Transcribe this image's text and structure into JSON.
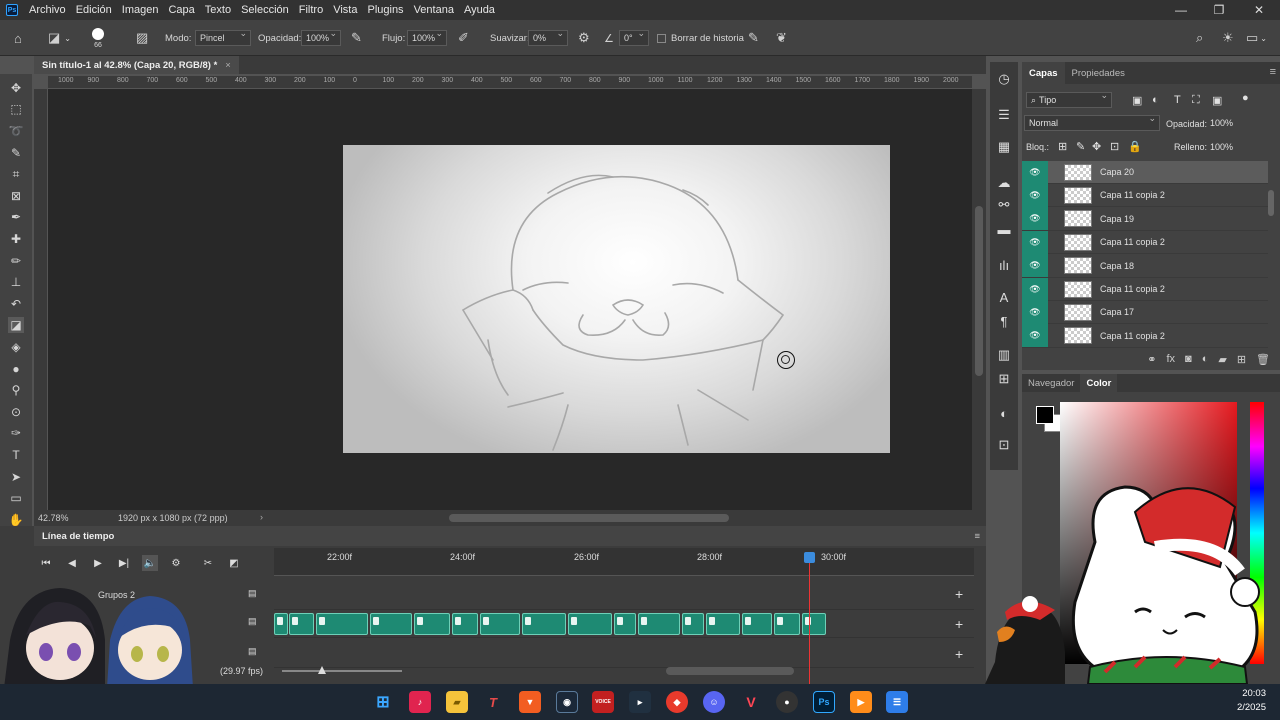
{
  "app": {
    "logo": "Ps",
    "menu": [
      "Archivo",
      "Edición",
      "Imagen",
      "Capa",
      "Texto",
      "Selección",
      "Filtro",
      "Vista",
      "Plugins",
      "Ventana",
      "Ayuda"
    ]
  },
  "options": {
    "brush_size": "66",
    "mode_label": "Modo:",
    "mode_value": "Pincel",
    "opacity_label": "Opacidad:",
    "opacity_value": "100%",
    "flow_label": "Flujo:",
    "flow_value": "100%",
    "smooth_label": "Suavizar:",
    "smooth_value": "0%",
    "angle_value": "0°",
    "history_label": "Borrar de historia"
  },
  "document": {
    "tab_title": "Sin título-1 al 42.8% (Capa 20, RGB/8) *",
    "zoom": "42.78%",
    "size_info": "1920 px x 1080 px (72 ppp)"
  },
  "ruler_top_labels": [
    "1000",
    "900",
    "800",
    "700",
    "600",
    "500",
    "400",
    "300",
    "200",
    "100",
    "0",
    "100",
    "200",
    "300",
    "400",
    "500",
    "600",
    "700",
    "800",
    "900",
    "1000",
    "1100",
    "1200",
    "1300",
    "1400",
    "1500",
    "1600",
    "1700",
    "1800",
    "1900",
    "2000",
    "2100"
  ],
  "timeline": {
    "title": "Línea de tiempo",
    "time_labels": [
      "22:00f",
      "24:00f",
      "26:00f",
      "28:00f",
      "30:00f"
    ],
    "track_name": "Grupos 2",
    "fps": "(29.97 fps)"
  },
  "layers_panel": {
    "tabs": [
      "Capas",
      "Propiedades"
    ],
    "filter": "Tipo",
    "blend_mode": "Normal",
    "opacity_label": "Opacidad:",
    "opacity_value": "100%",
    "lock_label": "Bloq.:",
    "fill_label": "Relleno:",
    "fill_value": "100%",
    "layers": [
      {
        "name": "Capa 20",
        "selected": true
      },
      {
        "name": "Capa 11 copia 2",
        "selected": false
      },
      {
        "name": "Capa 19",
        "selected": false
      },
      {
        "name": "Capa 11 copia 2",
        "selected": false
      },
      {
        "name": "Capa 18",
        "selected": false
      },
      {
        "name": "Capa 11 copia 2",
        "selected": false
      },
      {
        "name": "Capa 17",
        "selected": false
      },
      {
        "name": "Capa 11 copia 2",
        "selected": false
      }
    ]
  },
  "color_panel": {
    "tabs": [
      "Navegador",
      "Color"
    ],
    "foreground": "#000000",
    "background": "#ffffff",
    "hue_color": "#e6191f"
  },
  "taskbar": {
    "time": "20:03",
    "date": "2/2025",
    "apps": [
      "windows-start",
      "tiktok",
      "file-explorer",
      "typora",
      "brave",
      "steam",
      "voicemeeter",
      "terminal",
      "anydesk",
      "discord",
      "valorant",
      "obs",
      "photoshop",
      "media-player",
      "notepad"
    ]
  },
  "colors": {
    "accent_teal": "#1e8a73",
    "playhead": "#e33333",
    "panel_bg": "#424242"
  }
}
